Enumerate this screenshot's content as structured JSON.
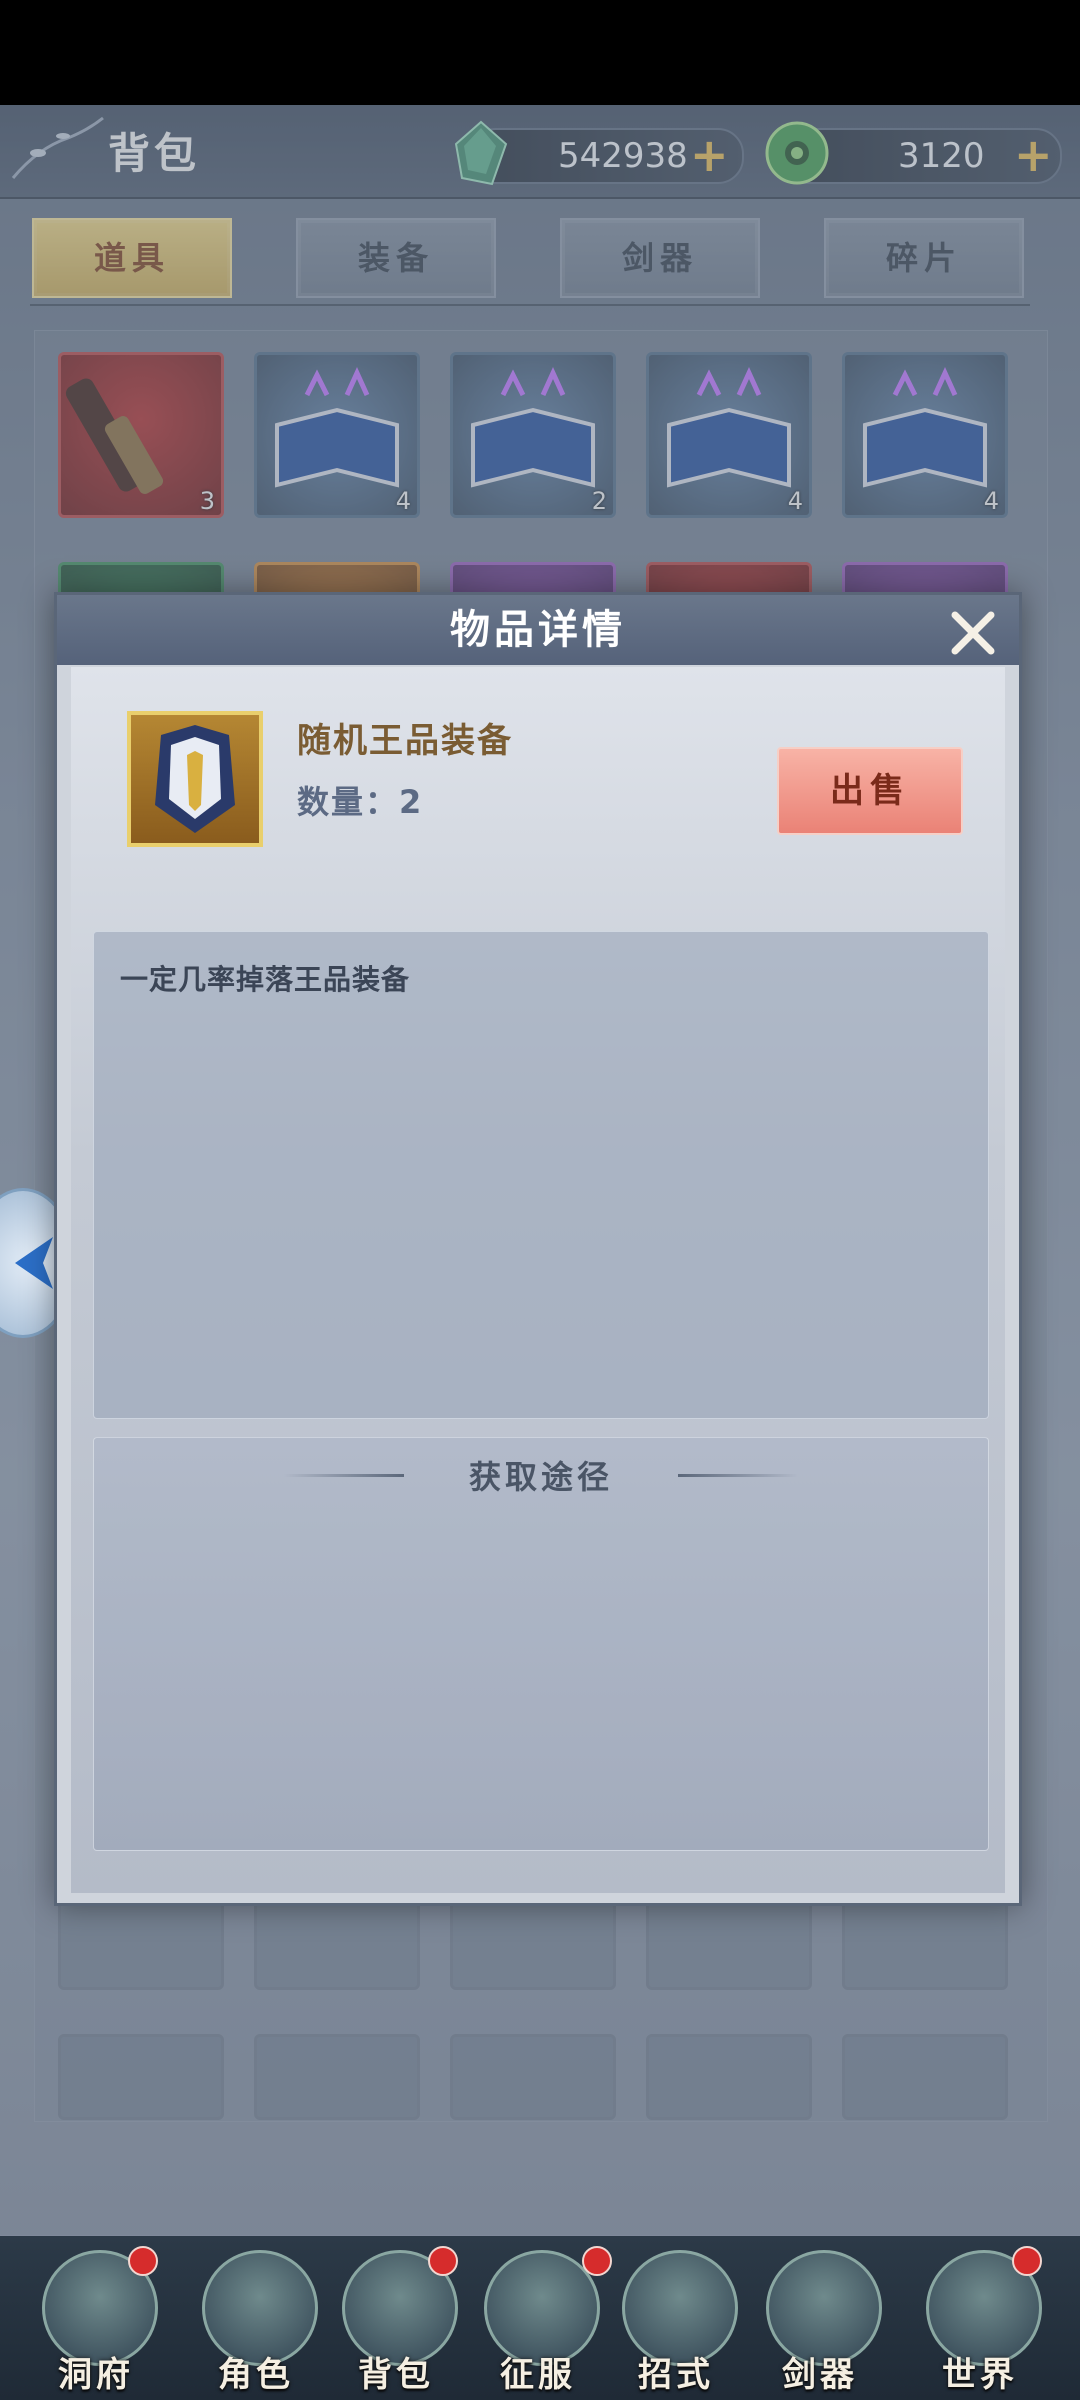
{
  "header": {
    "title": "背包",
    "jade_amount": "542938",
    "coin_amount": "3120",
    "plus": "+"
  },
  "tabs": [
    {
      "label": "道具",
      "active": true
    },
    {
      "label": "装备",
      "active": false
    },
    {
      "label": "剑器",
      "active": false
    },
    {
      "label": "碎片",
      "active": false
    }
  ],
  "grid": {
    "row1": [
      {
        "icon": "sword-hilt-icon",
        "qty": "3"
      },
      {
        "icon": "scroll-book-icon",
        "qty": "4"
      },
      {
        "icon": "scroll-book-icon",
        "qty": "2"
      },
      {
        "icon": "scroll-book-icon",
        "qty": "4"
      },
      {
        "icon": "scroll-book-icon",
        "qty": "4"
      }
    ]
  },
  "modal": {
    "title": "物品详情",
    "item_name": "随机王品装备",
    "item_qty": "数量：2",
    "sell_label": "出售",
    "description": "一定几率掉落王品装备",
    "source_title": "获取途径"
  },
  "bottom_nav": [
    {
      "label": "洞府",
      "badge": true
    },
    {
      "label": "角色",
      "badge": false
    },
    {
      "label": "背包",
      "badge": true
    },
    {
      "label": "征服",
      "badge": false
    },
    {
      "label": "招式",
      "badge": true
    },
    {
      "label": "剑器",
      "badge": false
    },
    {
      "label": "世界",
      "badge": true
    }
  ],
  "colors": {
    "active_tab": "#d9bd67",
    "sell_button": "#ef958a",
    "badge": "#d62c2c"
  }
}
